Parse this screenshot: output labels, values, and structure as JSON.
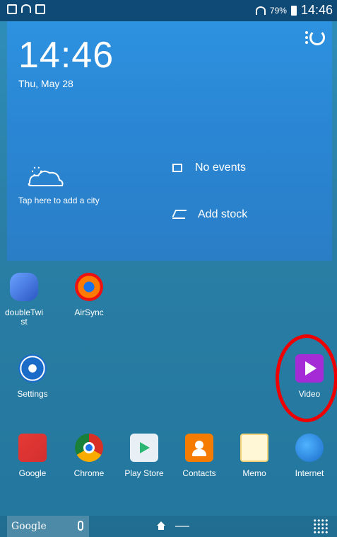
{
  "status": {
    "battery_pct": "79%",
    "time": "14:46"
  },
  "widget": {
    "clock": "14:46",
    "date": "Thu, May 28",
    "weather_hint": "Tap here to add a city",
    "events": "No events",
    "stock": "Add stock"
  },
  "home_apps": [
    {
      "label": "doubleTwi\nst"
    },
    {
      "label": "AirSync"
    },
    {
      "label": "Settings"
    },
    {
      "label": "Video"
    }
  ],
  "dock": [
    {
      "label": "Google"
    },
    {
      "label": "Chrome"
    },
    {
      "label": "Play Store"
    },
    {
      "label": "Contacts"
    },
    {
      "label": "Memo"
    },
    {
      "label": "Internet"
    }
  ],
  "bottom": {
    "search_label": "Google"
  },
  "colors": {
    "accent": "#2a86d4",
    "status_bar": "#0f4a76",
    "highlight": "#e00000"
  }
}
